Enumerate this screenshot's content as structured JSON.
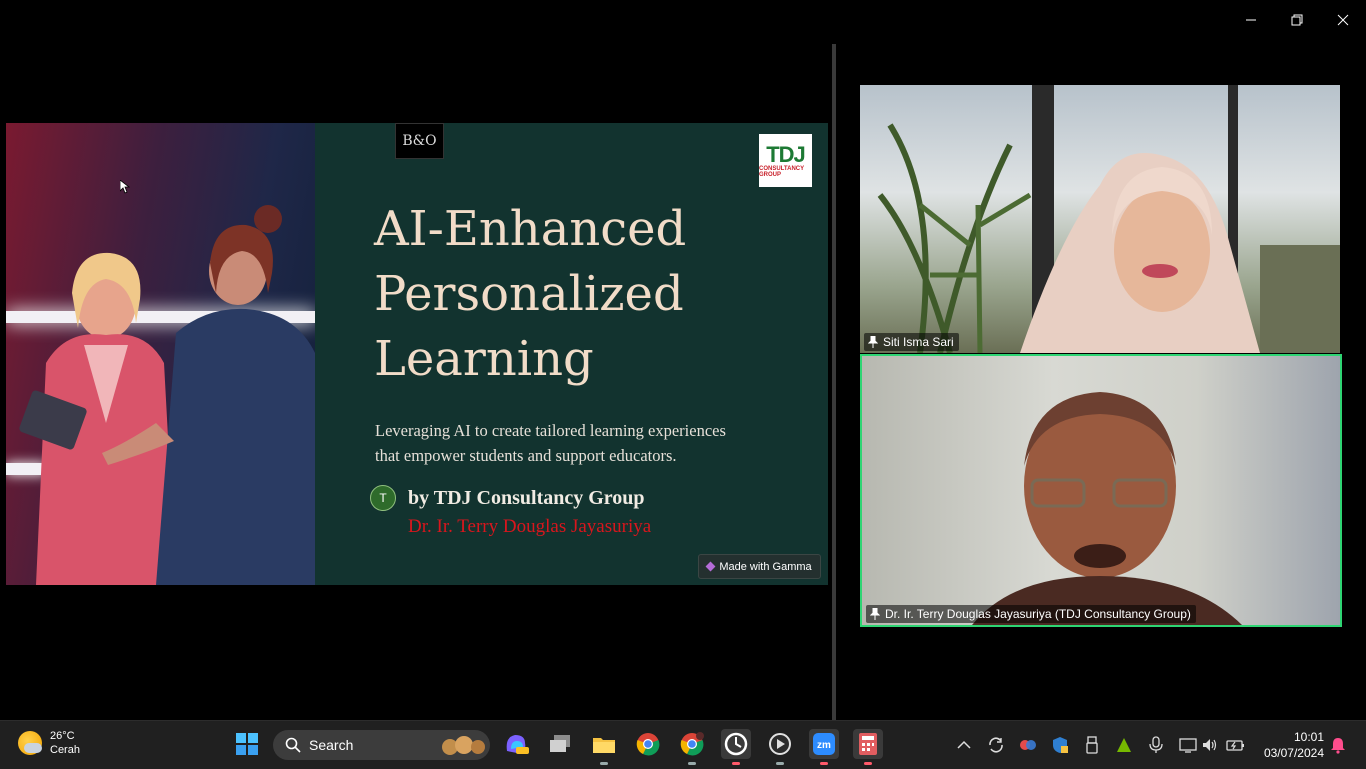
{
  "window": {
    "minimize_icon": "minimize-icon",
    "restore_icon": "restore-icon",
    "close_icon": "close-icon"
  },
  "slide": {
    "logo_left": "B&O",
    "logo_right_main": "TDJ",
    "logo_right_sub": "CONSULTANCY GROUP",
    "title_lines": [
      "AI-Enhanced",
      "Personalized",
      "Learning"
    ],
    "subtitle_line1": "Leveraging AI to create tailored learning experiences",
    "subtitle_line2": "that empower students and support educators.",
    "avatar_letter": "T",
    "by_line": "by TDJ Consultancy Group",
    "presenter": "Dr. Ir. Terry Douglas Jayasuriya",
    "gamma_badge": "Made with Gamma"
  },
  "participants": [
    {
      "name": "Siti Isma Sari"
    },
    {
      "name": "Dr. Ir. Terry Douglas Jayasuriya (TDJ Consultancy Group)"
    }
  ],
  "taskbar": {
    "weather_temp": "26°C",
    "weather_desc": "Cerah",
    "search_placeholder": "Search",
    "apps": [
      "start-icon",
      "search",
      "copilot-icon",
      "task-view-icon",
      "file-explorer-icon",
      "chrome-icon",
      "chrome-profile-icon",
      "recorder-icon",
      "media-player-icon",
      "zoom-icon",
      "calculator-icon"
    ],
    "clock_time": "10:01",
    "clock_date": "03/07/2024"
  },
  "colors": {
    "active_speaker_border": "#2ed573",
    "slide_bg": "#12332f",
    "title_color": "#f1dcc8",
    "presenter_red": "#d8161d"
  }
}
